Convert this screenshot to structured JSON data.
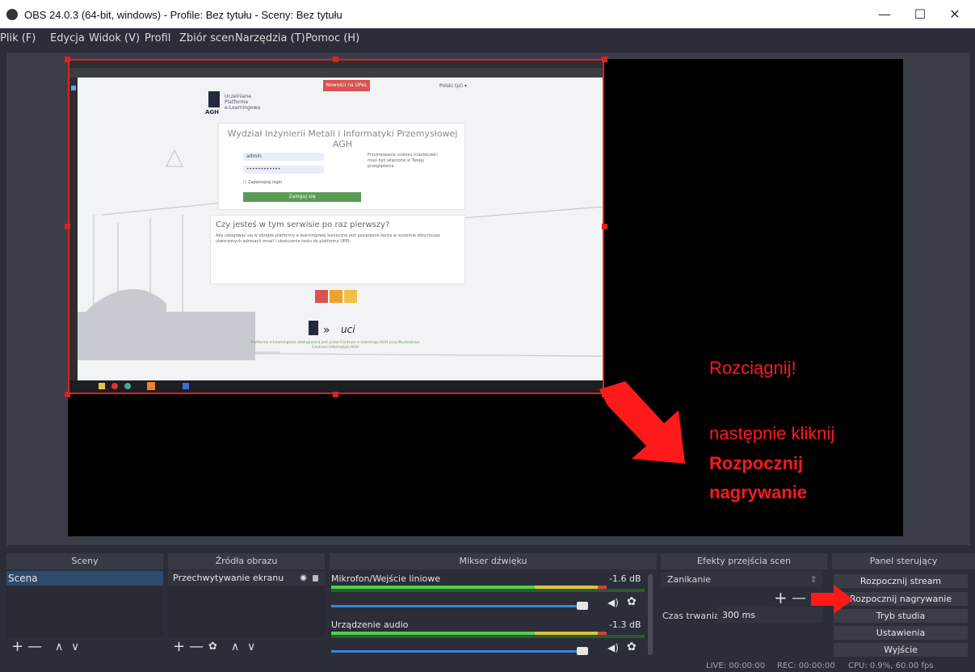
{
  "window": {
    "title": "OBS 24.0.3 (64-bit, windows) - Profile: Bez tytułu - Sceny: Bez tytułu",
    "minimize": "—",
    "maximize": "☐",
    "close": "✕"
  },
  "menu": [
    "Plik (F)",
    "Edycja",
    "Widok (V)",
    "Profil",
    "Zbiór scen",
    "Narzędzia (T)",
    "Pomoc (H)"
  ],
  "preview": {
    "captured": {
      "site_badge": "Nowości na UPeL",
      "login_link": "Polski (pl) ▾",
      "logo_lines": [
        "Uczelniana",
        "Platforma",
        "e-Learningowa"
      ],
      "logo_abbr": "AGH",
      "heading": "Wydział Inżynierii Metali i Informatyki Przemysłowej AGH",
      "username": "admin",
      "password": "••••••••••••",
      "remember": "☐ Zapamiętaj login",
      "login_button": "Zaloguj się",
      "cookie_note": "Przyjmowanie cookies (ciasteczek) musi być włączone w Twojej przeglądarce",
      "first_time_heading": "Czy jesteś w tym serwisie po raz pierwszy?",
      "first_time_text": "Aby zalogować się w obrębie platformy e-learningowej konieczne jest posiadanie konta w systemie dotychczas utworzonych adresach email i ukończenie testu do platformy UPEL",
      "footer_text": "Platforma e-Learningowa obsługiwana jest przez Centrum e-Learningu AGH oraz Wydziałowe Centrum Informatyki AGH"
    },
    "annotations": {
      "line1": "Rozciągnij!",
      "line2": "następnie kliknij",
      "line3": "Rozpocznij",
      "line4": "nagrywanie"
    }
  },
  "docks": {
    "scenes": {
      "title": "Sceny",
      "items": [
        "Scena"
      ]
    },
    "sources": {
      "title": "Źródła obrazu",
      "items": [
        "Przechwytywanie ekranu"
      ]
    },
    "mixer": {
      "title": "Mikser dźwięku",
      "channels": [
        {
          "name": "Mikrofon/Wejście liniowe",
          "db": "-1.6 dB",
          "level": 0.88
        },
        {
          "name": "Urządzenie audio",
          "db": "-1.3 dB",
          "level": 0.88
        }
      ]
    },
    "transitions": {
      "title": "Efekty przejścia scen",
      "selected": "Zanikanie",
      "duration_label": "Czas trwania",
      "duration_value": "300 ms"
    },
    "controls": {
      "title": "Panel sterujący",
      "buttons": [
        "Rozpocznij stream",
        "Rozpocznij nagrywanie",
        "Tryb studia",
        "Ustawienia",
        "Wyjście"
      ]
    }
  },
  "statusbar": {
    "live": "LIVE: 00:00:00",
    "rec": "REC: 00:00:00",
    "cpu": "CPU: 0.9%, 60.00 fps"
  },
  "icons": {
    "plus": "+",
    "minus": "—",
    "up": "∧",
    "down": "∨",
    "gear": "✿",
    "speaker": "◀)",
    "eye": "◉",
    "lock": "🔒"
  }
}
